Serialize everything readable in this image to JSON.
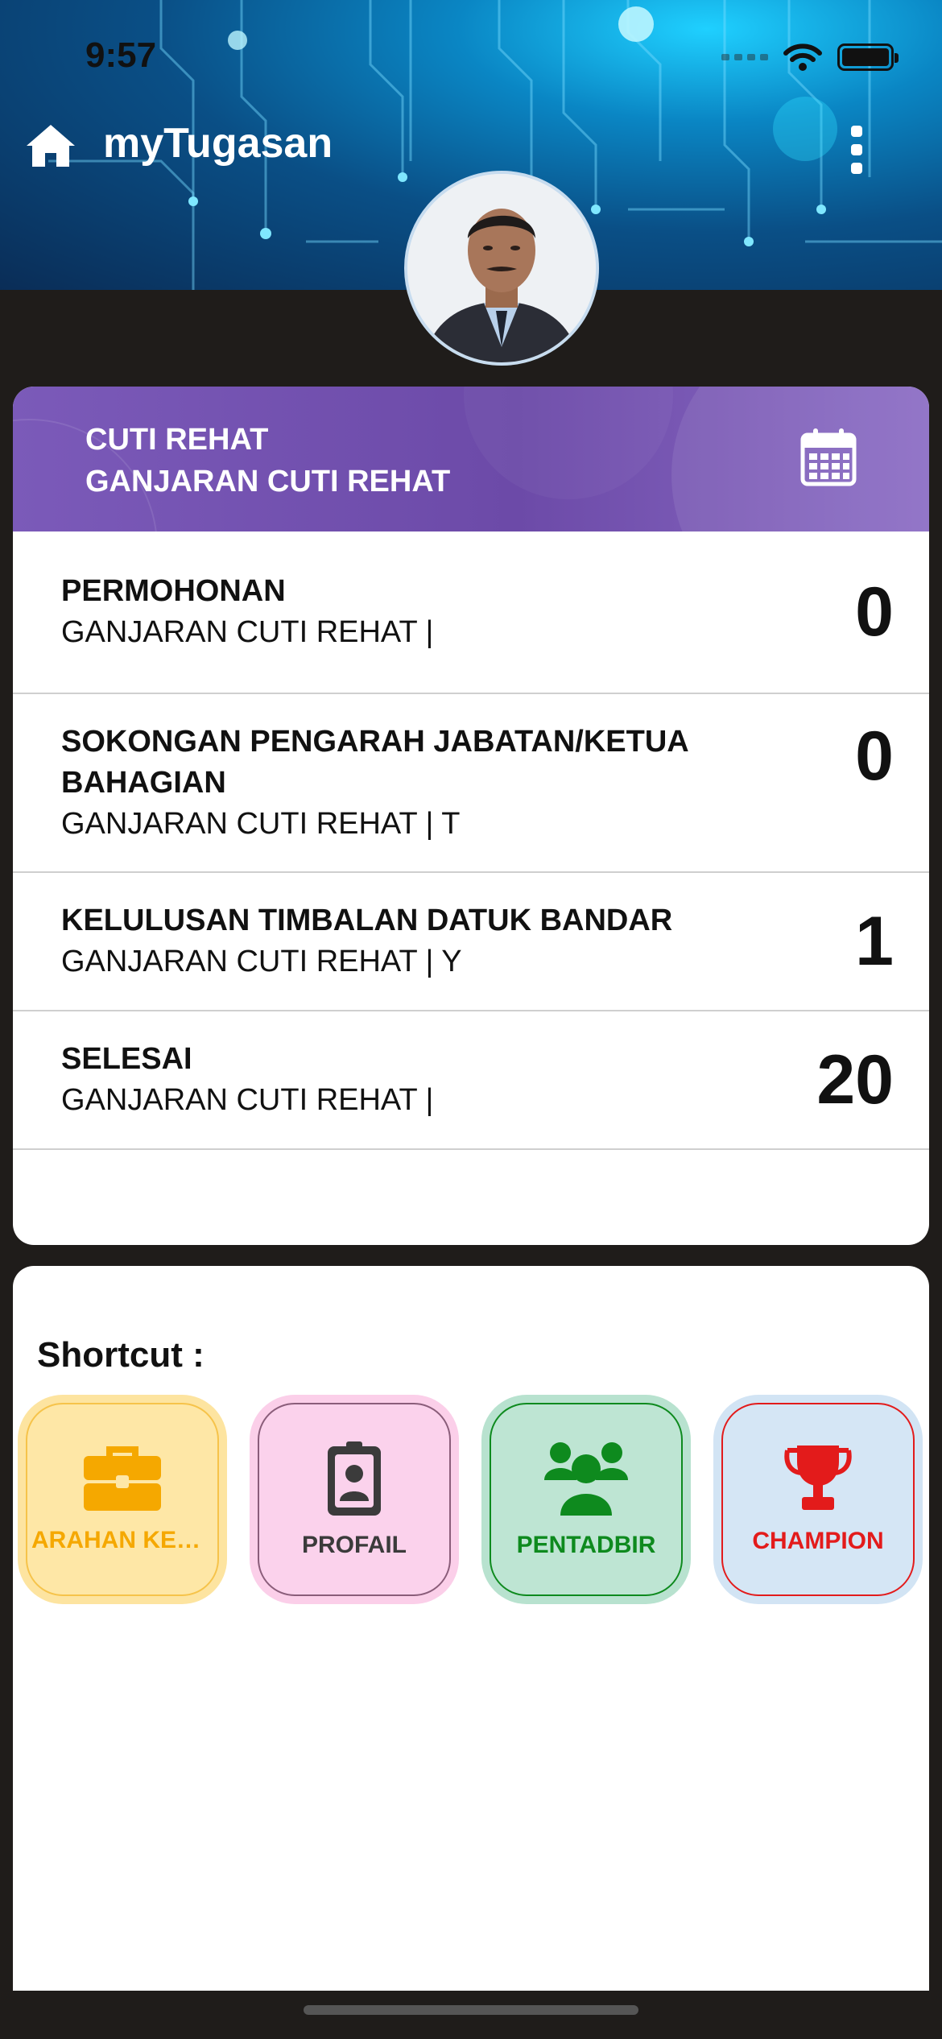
{
  "status_bar": {
    "time": "9:57"
  },
  "app_bar": {
    "title": "myTugasan",
    "home_icon": "home-icon",
    "menu_icon": "more-vertical-icon"
  },
  "profile": {
    "avatar": "avatar"
  },
  "leave_card": {
    "title_line1": "CUTI REHAT",
    "title_line2": "GANJARAN CUTI REHAT",
    "icon": "calendar-icon",
    "header_color": "#7453B1",
    "rows": [
      {
        "title": "PERMOHONAN",
        "subtitle": "GANJARAN CUTI REHAT |",
        "count": "0"
      },
      {
        "title": "SOKONGAN PENGARAH JABATAN/KETUA BAHAGIAN",
        "subtitle": "GANJARAN CUTI REHAT | T",
        "count": "0"
      },
      {
        "title": "KELULUSAN TIMBALAN DATUK BANDAR",
        "subtitle": "GANJARAN CUTI REHAT | Y",
        "count": "1"
      },
      {
        "title": "SELESAI",
        "subtitle": "GANJARAN CUTI REHAT |",
        "count": "20"
      }
    ]
  },
  "shortcuts": {
    "label": "Shortcut :",
    "items": [
      {
        "label": "ARAHAN KER...",
        "icon": "briefcase-icon",
        "bg": "#FEE7A6",
        "color": "#F5A800"
      },
      {
        "label": "PROFAIL",
        "icon": "id-badge-icon",
        "bg": "#FBD2EC",
        "color": "#3B3B3B"
      },
      {
        "label": "PENTADBIR",
        "icon": "users-icon",
        "bg": "#BEE5D3",
        "color": "#0E8A1E"
      },
      {
        "label": "CHAMPION",
        "icon": "trophy-icon",
        "bg": "#D5E6F5",
        "color": "#E31B1B"
      }
    ]
  }
}
